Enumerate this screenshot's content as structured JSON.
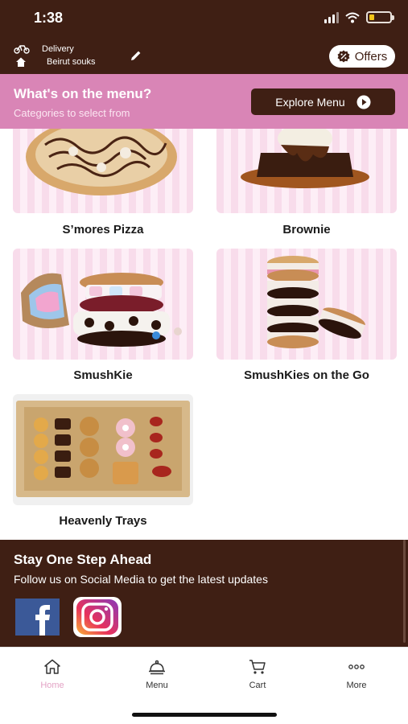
{
  "status": {
    "time": "1:38",
    "battery_level": 0.25,
    "battery_color": "#f2c418"
  },
  "header": {
    "delivery_label": "Delivery",
    "location": "Beirut souks",
    "offers_label": "Offers",
    "offers_icon": "badge-percent-icon",
    "brand_color": "#3f1f14"
  },
  "banner": {
    "title": "What's on the menu?",
    "subtitle": "Categories to select from",
    "button_label": "Explore Menu",
    "color": "#d985b6"
  },
  "categories": [
    {
      "label": "S’mores Pizza"
    },
    {
      "label": "Brownie"
    },
    {
      "label": "SmushKie"
    },
    {
      "label": "SmushKies on the Go"
    },
    {
      "label": "Heavenly Trays"
    }
  ],
  "social": {
    "title": "Stay One Step Ahead",
    "subtitle": "Follow us on Social Media to get the latest updates",
    "icons": [
      "facebook-icon",
      "instagram-icon"
    ]
  },
  "tabs": [
    {
      "label": "Home",
      "icon": "home-icon",
      "active": true
    },
    {
      "label": "Menu",
      "icon": "cloche-icon",
      "active": false
    },
    {
      "label": "Cart",
      "icon": "cart-icon",
      "active": false
    },
    {
      "label": "More",
      "icon": "more-icon",
      "active": false
    }
  ],
  "colors": {
    "active_tab": "#e3a3c5",
    "card_stripe": "#f8dceb"
  }
}
